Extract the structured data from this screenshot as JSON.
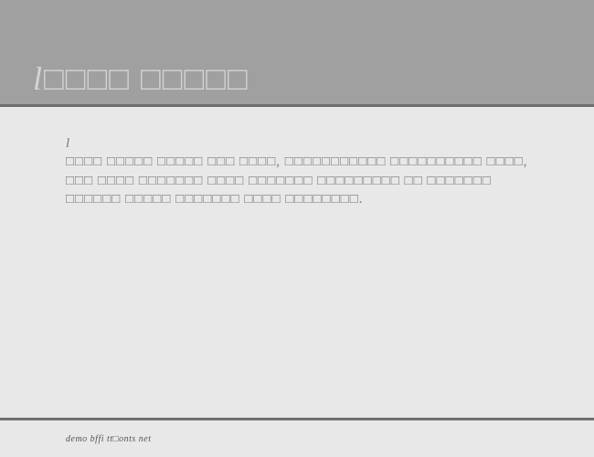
{
  "header": {
    "title_first": "l",
    "title_rest": "□□□□ □□□□□"
  },
  "content": {
    "body_first": "l",
    "body_rest": "□□□□ □□□□□ □□□□□ □□□ □□□□, □□□□□□□□□□□ □□□□□□□□□□ □□□□, □□□ □□□□ □□□□□□□ □□□□ □□□□□□□ □□□□□□□□□ □□ □□□□□□□ □□□□□□ □□□□□ □□□□□□□ □□□□ □□□□□□□□."
  },
  "footer": {
    "text": "demo bffi tt□onts net"
  }
}
